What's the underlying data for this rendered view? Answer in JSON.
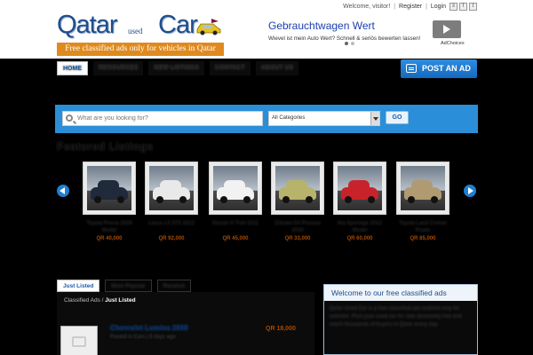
{
  "logo": {
    "title": "Qatar",
    "used": "used",
    "car": "Car",
    "tagline": "Free classified ads only for vehicles in Qatar"
  },
  "top_links": {
    "welcome": "Welcome, visitor!",
    "register": "Register",
    "login": "Login"
  },
  "ad": {
    "title": "Gebrauchtwagen Wert",
    "text": "Wievel ist mein Auto Wert? Schnell & seriös bewerten lassen!",
    "choices": "AdChoices"
  },
  "nav": {
    "items": [
      "HOME",
      "RESOURCES",
      "NEW LISTINGS",
      "CONTACT",
      "ABOUT US"
    ]
  },
  "post_ad": {
    "label": "POST AN AD"
  },
  "search": {
    "placeholder": "What are you looking for?",
    "category": "All Categories",
    "go": "GO"
  },
  "featured": {
    "title": "Featured Listings",
    "items": [
      {
        "title": "Toyota Previa 2006 Model",
        "price": "QR 40,000",
        "color": "#1f2a3a"
      },
      {
        "title": "Lexus LX 570 2012",
        "price": "QR 92,000",
        "color": "#e9e9e9"
      },
      {
        "title": "Nissan X-Trail 2011",
        "price": "QR 45,000",
        "color": "#f2f2f2"
      },
      {
        "title": "Citroen C4 Picasso 2010",
        "price": "QR 33,000",
        "color": "#b8b36a"
      },
      {
        "title": "Kia Sportage 2012 Model",
        "price": "QR 60,000",
        "color": "#c8232b"
      },
      {
        "title": "Toyota Land Cruiser Prado",
        "price": "QR 85,000",
        "color": "#b09a72"
      }
    ]
  },
  "tabs": [
    "Just Listed",
    "Most Popular",
    "Random"
  ],
  "listing": {
    "breadcrumb_root": "Classified Ads",
    "breadcrumb_current": "Just Listed",
    "title": "Chevrolet Lumina 2008",
    "meta": "Posted in Cars | 5 days ago",
    "price": "QR 18,000"
  },
  "welcome": {
    "heading": "Welcome to our free classified ads",
    "text": "Qatar Used Car is a free classified ads website only for vehicles. Post your used car for sale absolutely free and reach thousands of buyers in Qatar every day."
  }
}
